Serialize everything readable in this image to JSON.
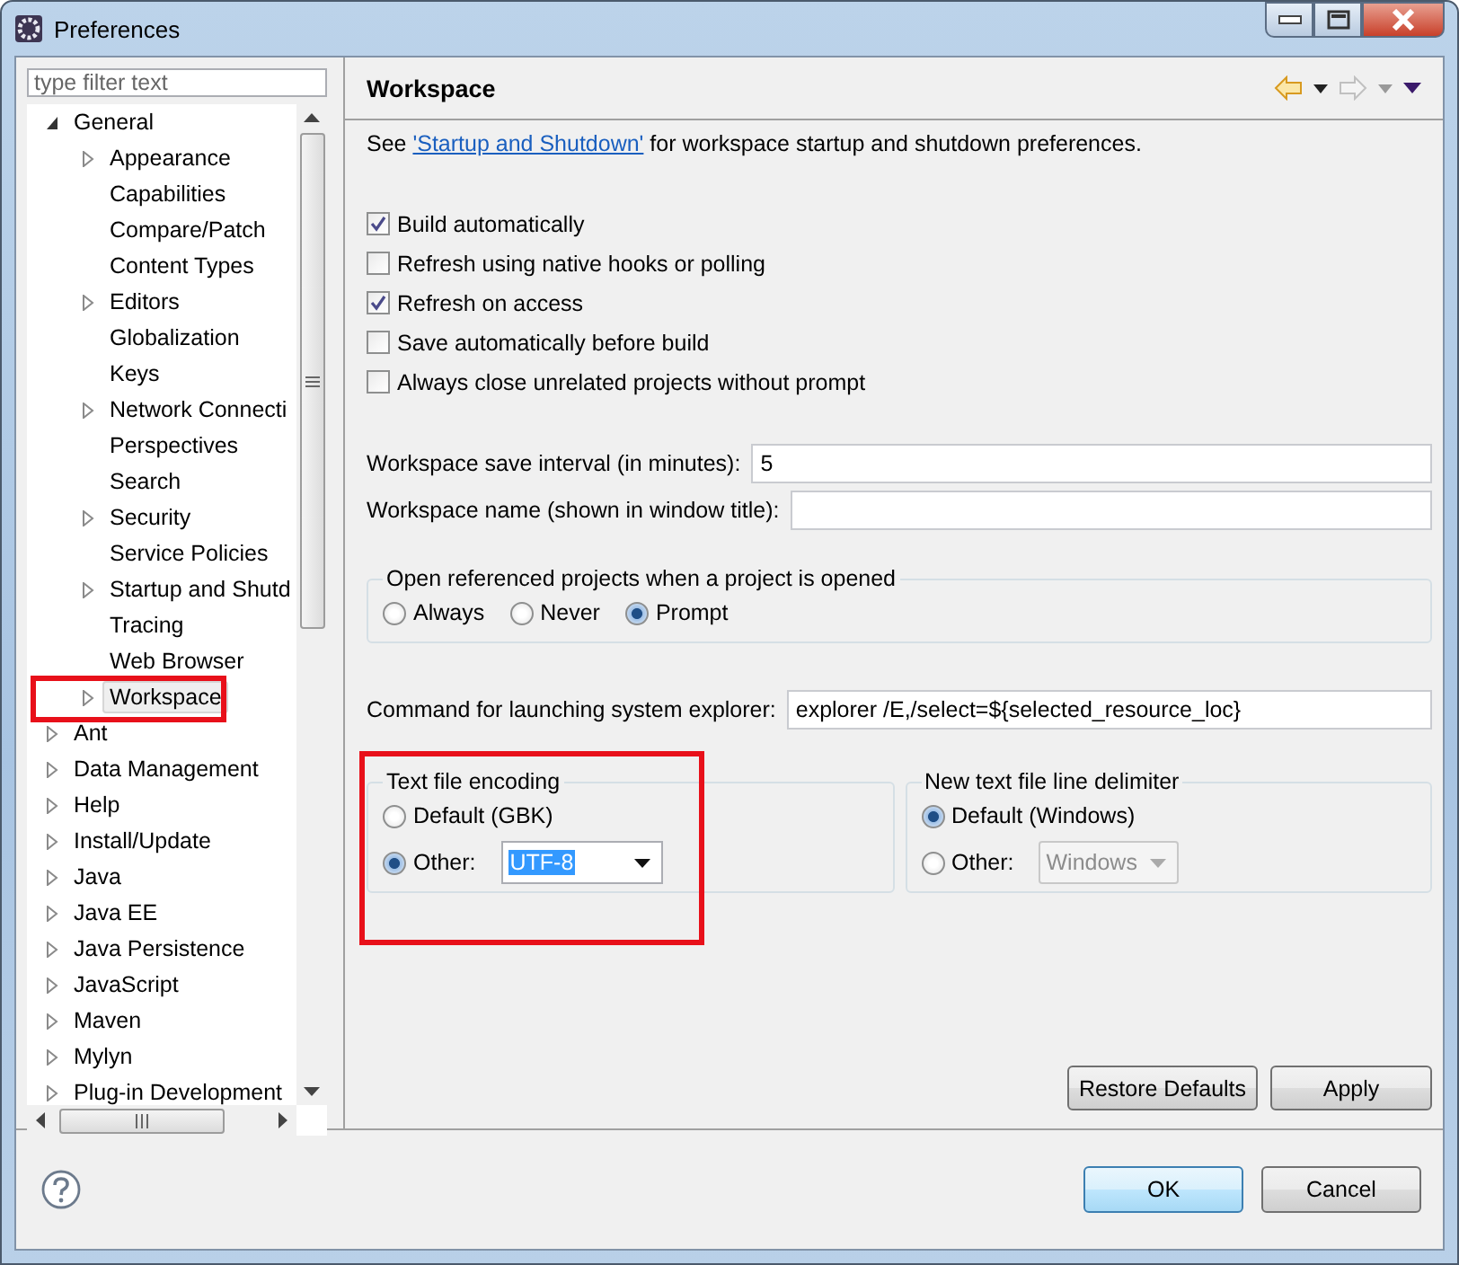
{
  "window": {
    "title": "Preferences"
  },
  "filter": {
    "placeholder": "type filter text"
  },
  "tree": [
    {
      "label": "General",
      "expandable": true,
      "expanded": true,
      "selected": false,
      "children": [
        {
          "label": "Appearance",
          "expandable": true,
          "expanded": false,
          "selected": false
        },
        {
          "label": "Capabilities",
          "expandable": false,
          "selected": false
        },
        {
          "label": "Compare/Patch",
          "expandable": false,
          "selected": false
        },
        {
          "label": "Content Types",
          "expandable": false,
          "selected": false
        },
        {
          "label": "Editors",
          "expandable": true,
          "expanded": false,
          "selected": false
        },
        {
          "label": "Globalization",
          "expandable": false,
          "selected": false
        },
        {
          "label": "Keys",
          "expandable": false,
          "selected": false
        },
        {
          "label": "Network Connecti",
          "expandable": true,
          "expanded": false,
          "selected": false
        },
        {
          "label": "Perspectives",
          "expandable": false,
          "selected": false
        },
        {
          "label": "Search",
          "expandable": false,
          "selected": false
        },
        {
          "label": "Security",
          "expandable": true,
          "expanded": false,
          "selected": false
        },
        {
          "label": "Service Policies",
          "expandable": false,
          "selected": false
        },
        {
          "label": "Startup and Shutd",
          "expandable": true,
          "expanded": false,
          "selected": false
        },
        {
          "label": "Tracing",
          "expandable": false,
          "selected": false
        },
        {
          "label": "Web Browser",
          "expandable": false,
          "selected": false
        },
        {
          "label": "Workspace",
          "expandable": true,
          "expanded": false,
          "selected": true,
          "highlighted": true
        }
      ]
    },
    {
      "label": "Ant",
      "expandable": true,
      "expanded": false,
      "selected": false
    },
    {
      "label": "Data Management",
      "expandable": true,
      "expanded": false,
      "selected": false
    },
    {
      "label": "Help",
      "expandable": true,
      "expanded": false,
      "selected": false
    },
    {
      "label": "Install/Update",
      "expandable": true,
      "expanded": false,
      "selected": false
    },
    {
      "label": "Java",
      "expandable": true,
      "expanded": false,
      "selected": false
    },
    {
      "label": "Java EE",
      "expandable": true,
      "expanded": false,
      "selected": false
    },
    {
      "label": "Java Persistence",
      "expandable": true,
      "expanded": false,
      "selected": false
    },
    {
      "label": "JavaScript",
      "expandable": true,
      "expanded": false,
      "selected": false
    },
    {
      "label": "Maven",
      "expandable": true,
      "expanded": false,
      "selected": false
    },
    {
      "label": "Mylyn",
      "expandable": true,
      "expanded": false,
      "selected": false
    },
    {
      "label": "Plug-in Development",
      "expandable": true,
      "expanded": false,
      "selected": false
    }
  ],
  "page": {
    "title": "Workspace",
    "intro": {
      "before": "See ",
      "link": "'Startup and Shutdown'",
      "after": " for workspace startup and shutdown preferences."
    },
    "checkboxes": [
      {
        "label": "Build automatically",
        "checked": true
      },
      {
        "label": "Refresh using native hooks or polling",
        "checked": false
      },
      {
        "label": "Refresh on access",
        "checked": true
      },
      {
        "label": "Save automatically before build",
        "checked": false
      },
      {
        "label": "Always close unrelated projects without prompt",
        "checked": false
      }
    ],
    "fields": [
      {
        "label": "Workspace save interval (in minutes):",
        "value": "5"
      },
      {
        "label": "Workspace name (shown in window title):"
      }
    ],
    "open_projects": {
      "title": "Open referenced projects when a project is opened",
      "options": [
        {
          "label": "Always",
          "selected": false
        },
        {
          "label": "Never",
          "selected": false
        },
        {
          "label": "Prompt",
          "selected": true
        }
      ]
    },
    "explorer": {
      "label": "Command for launching system explorer:",
      "value": "explorer /E,/select=${selected_resource_loc}"
    },
    "encoding": {
      "title": "Text file encoding",
      "highlighted": true,
      "options": [
        {
          "label": "Default (GBK)",
          "selected": false
        },
        {
          "label": "Other:",
          "selected": true
        }
      ],
      "combo": {
        "value": "UTF-8",
        "disabled": false
      }
    },
    "delimiter": {
      "title": "New text file line delimiter",
      "options": [
        {
          "label": "Default (Windows)",
          "selected": true
        },
        {
          "label": "Other:",
          "selected": false
        }
      ],
      "combo": {
        "value": "Windows",
        "disabled": true
      }
    },
    "buttons": [
      "Restore Defaults",
      "Apply"
    ]
  },
  "dialog_buttons": [
    {
      "label": "OK",
      "default": true
    },
    {
      "label": "Cancel",
      "default": false
    }
  ]
}
